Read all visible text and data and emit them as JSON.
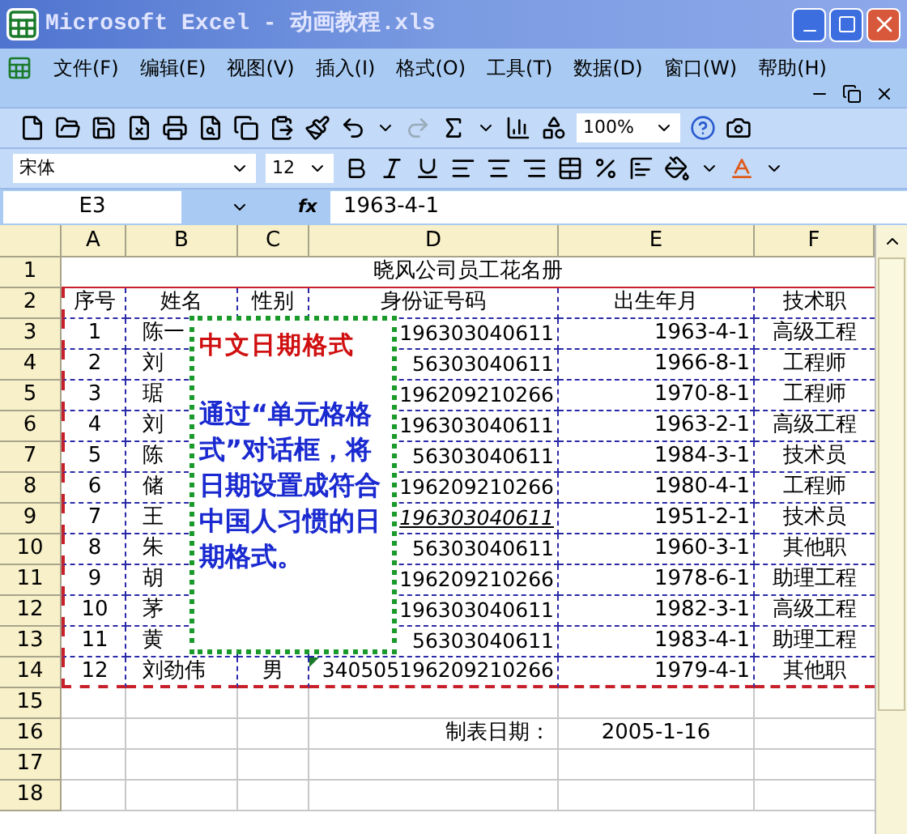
{
  "window": {
    "title": "Microsoft Excel - 动画教程.xls"
  },
  "menu": [
    {
      "label": "文件(F)"
    },
    {
      "label": "编辑(E)"
    },
    {
      "label": "视图(V)"
    },
    {
      "label": "插入(I)"
    },
    {
      "label": "格式(O)"
    },
    {
      "label": "工具(T)"
    },
    {
      "label": "数据(D)"
    },
    {
      "label": "窗口(W)"
    },
    {
      "label": "帮助(H)"
    }
  ],
  "toolbar": {
    "zoom": "100%"
  },
  "format_bar": {
    "font": "宋体",
    "size": "12"
  },
  "formula_bar": {
    "name_box": "E3",
    "function_label": "fx",
    "formula": "1963-4-1"
  },
  "columns": [
    "A",
    "B",
    "C",
    "D",
    "E",
    "F"
  ],
  "rows": [
    {
      "number": "1",
      "kind": "title",
      "text": "晓风公司员工花名册"
    },
    {
      "number": "2",
      "kind": "header",
      "cells": [
        "序号",
        "姓名",
        "性别",
        "身份证号码",
        "出生年月",
        "技术职"
      ]
    },
    {
      "number": "3",
      "kind": "data",
      "no": "1",
      "name": "陈一",
      "id": "196303040611",
      "birth": "1963-4-1",
      "title": "高级工程",
      "italic": false
    },
    {
      "number": "4",
      "kind": "data",
      "no": "2",
      "name": "刘",
      "id": "56303040611",
      "birth": "1966-8-1",
      "title": "工程师",
      "italic": false
    },
    {
      "number": "5",
      "kind": "data",
      "no": "3",
      "name": "琚",
      "id": "196209210266",
      "birth": "1970-8-1",
      "title": "工程师",
      "italic": false
    },
    {
      "number": "6",
      "kind": "data",
      "no": "4",
      "name": "刘",
      "id": "196303040611",
      "birth": "1963-2-1",
      "title": "高级工程",
      "italic": false
    },
    {
      "number": "7",
      "kind": "data",
      "no": "5",
      "name": "陈",
      "id": "56303040611",
      "birth": "1984-3-1",
      "title": "技术员",
      "italic": false
    },
    {
      "number": "8",
      "kind": "data",
      "no": "6",
      "name": "储",
      "id": "196209210266",
      "birth": "1980-4-1",
      "title": "工程师",
      "italic": false
    },
    {
      "number": "9",
      "kind": "data",
      "no": "7",
      "name": "王",
      "id": "196303040611",
      "birth": "1951-2-1",
      "title": "技术员",
      "italic": true
    },
    {
      "number": "10",
      "kind": "data",
      "no": "8",
      "name": "朱",
      "id": "56303040611",
      "birth": "1960-3-1",
      "title": "其他职",
      "italic": false
    },
    {
      "number": "11",
      "kind": "data",
      "no": "9",
      "name": "胡",
      "id": "196209210266",
      "birth": "1978-6-1",
      "title": "助理工程",
      "italic": false
    },
    {
      "number": "12",
      "kind": "data",
      "no": "10",
      "name": "茅",
      "id": "196303040611",
      "birth": "1982-3-1",
      "title": "高级工程",
      "italic": false
    },
    {
      "number": "13",
      "kind": "data",
      "no": "11",
      "name": "黄",
      "id": "56303040611",
      "birth": "1983-4-1",
      "title": "助理工程",
      "italic": false
    },
    {
      "number": "14",
      "kind": "data",
      "no": "12",
      "name": "刘劲伟",
      "gender": "男",
      "id": "340505196209210266",
      "birth": "1979-4-1",
      "title": "其他职",
      "italic": false
    },
    {
      "number": "15",
      "kind": "empty"
    },
    {
      "number": "16",
      "kind": "footer",
      "label": "制表日期：",
      "value": "2005-1-16"
    },
    {
      "number": "17",
      "kind": "empty"
    },
    {
      "number": "18",
      "kind": "empty"
    }
  ],
  "callout": {
    "heading": "中文日期格式",
    "body": "通过“单元格格式”对话框，将日期设置成符合中国人习惯的日期格式。"
  }
}
